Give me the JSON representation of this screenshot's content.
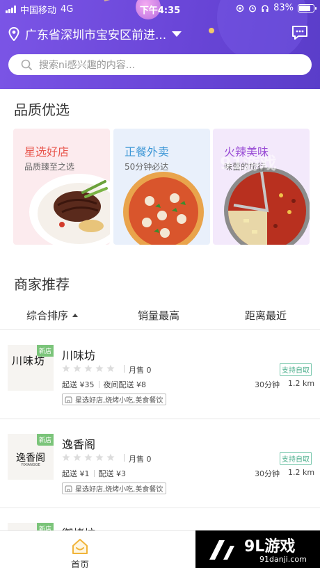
{
  "status_bar": {
    "carrier": "中国移动",
    "network": "4G",
    "time": "下午4:35",
    "battery_pct": "83%",
    "battery_level": 0.83
  },
  "header": {
    "location": "广东省深圳市宝安区前进...",
    "search_placeholder": "搜索ni感兴趣的内容..."
  },
  "quality": {
    "title": "品质优选",
    "cards": [
      {
        "title": "星选好店",
        "subtitle": "品质臻至之选",
        "title_color": "#e8574e",
        "bg": "#fcebee"
      },
      {
        "title": "正餐外卖",
        "subtitle": "50分钟必达",
        "title_color": "#3d97d6",
        "bg": "#e9f0fb"
      },
      {
        "title": "火辣美味",
        "subtitle": "味蕾的旅行",
        "title_color": "#9b4fd6",
        "bg": "#f3e9fb"
      }
    ]
  },
  "merchants_section": {
    "title": "商家推荐",
    "sort_default": "综合排序",
    "sort_sales": "销量最高",
    "sort_distance": "距离最近"
  },
  "merchants": [
    {
      "name": "川味坊",
      "badge": "新店",
      "logo_text": "川味坊",
      "monthly": "月售 0",
      "fee1": "起送 ¥35",
      "fee2": "夜间配送 ¥8",
      "pickup": "支持自取",
      "time": "30分钟",
      "distance": "1.2 km",
      "tags": "星选好店,烧烤小吃,美食餐饮"
    },
    {
      "name": "逸香阁",
      "badge": "新店",
      "logo_text": "逸香阁",
      "logo_sub": "YIXIANGGE",
      "monthly": "月售 0",
      "fee1": "起送 ¥1",
      "fee2": "配送 ¥3",
      "pickup": "支持自取",
      "time": "30分钟",
      "distance": "1.2 km",
      "tags": "星选好店,烧烤小吃,美食餐饮"
    },
    {
      "name": "御烤坊",
      "badge": "新店"
    }
  ],
  "tabbar": {
    "home": "首页"
  },
  "watermark": {
    "big": "9L游戏",
    "small": "91danji.com",
    "overlay": "91游戏"
  },
  "icons": {
    "location": "location-pin-icon",
    "message": "message-icon",
    "search": "search-icon",
    "star": "star-icon",
    "tag": "shop-icon",
    "home": "home-icon"
  },
  "colors": {
    "header": "#6a46d8",
    "pickup": "#4fb08e",
    "badge": "#7bc47a",
    "home_icon": "#f1b43a"
  }
}
